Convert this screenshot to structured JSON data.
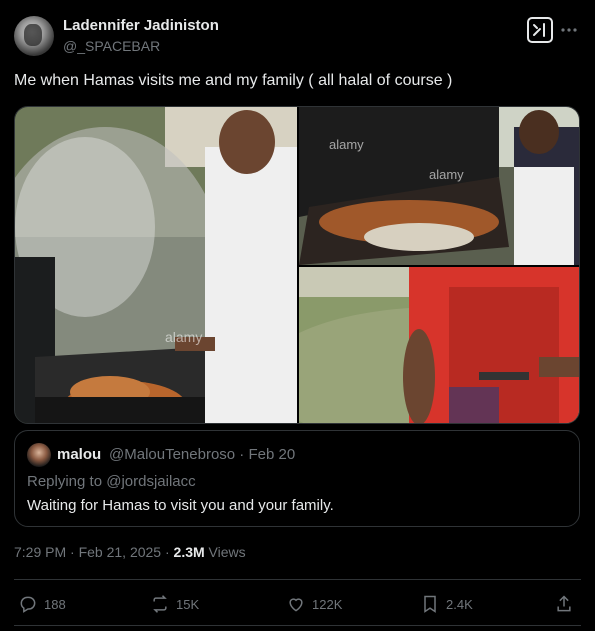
{
  "author": {
    "name": "Ladennifer Jadiniston",
    "handle": "@_SPACEBAR"
  },
  "tweet": {
    "text": "Me when Hamas visits me and my family ( all halal of course )"
  },
  "media": {
    "watermark": "alamy",
    "images": [
      {
        "icon": "grill-photo-icon"
      },
      {
        "icon": "grill-photo-icon"
      },
      {
        "icon": "grill-photo-icon"
      }
    ]
  },
  "quote": {
    "name": "malou",
    "handle_date": "@MalouTenebroso · Feb 20",
    "replying_prefix": "Replying to",
    "replying_to": "@jordsjailacc",
    "text": "Waiting for Hamas to visit you and your family."
  },
  "meta": {
    "time_date": "7:29 PM · Feb 21, 2025 · ",
    "views_count": "2.3M",
    "views_label": " Views"
  },
  "actions": {
    "replies": "188",
    "reposts": "15K",
    "likes": "122K",
    "bookmarks": "2.4K"
  },
  "colors": {
    "background": "#000000",
    "text": "#e7e9ea",
    "muted": "#71767b",
    "border": "#2f3336"
  }
}
